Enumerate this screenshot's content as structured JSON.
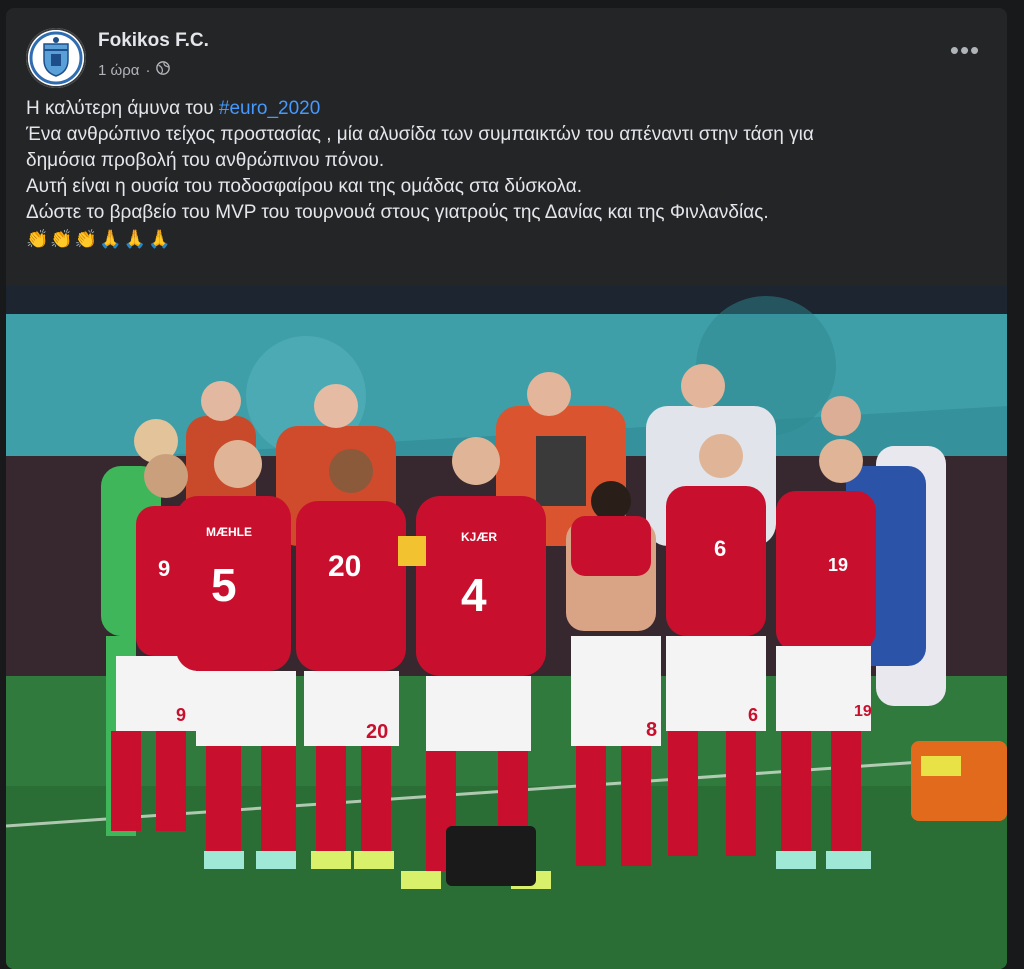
{
  "post": {
    "page_name": "Fokikos F.C.",
    "time": "1 ώρα",
    "separator": "·",
    "privacy_icon": "globe-icon",
    "more_icon": "more-options-icon",
    "avatar_icon": "club-crest-logo",
    "text_line1_prefix": "Η καλύτερη άμυνα του ",
    "hashtag": "#euro_2020",
    "text_line2": "Ένα ανθρώπινο τείχος προστασίας , μία αλυσίδα των συμπαικτών του απέναντι στην τάση για",
    "text_line3": "δημόσια προβολή του ανθρώπινου πόνου.",
    "text_line4": "Αυτή είναι η ουσία του ποδοσφαίρου και της ομάδας στα δύσκολα.",
    "text_line5": "Δώστε το βραβείο του MVP του τουρνουά στους γιατρούς της Δανίας και της Φινλανδίας.",
    "emojis": "👏👏👏🙏🙏🙏"
  },
  "photo": {
    "jersey_numbers": [
      "9",
      "5",
      "20",
      "4",
      "6",
      "19"
    ],
    "jersey_names": [
      "MÆHLE",
      "KJÆR"
    ],
    "shorts_numbers": [
      "9",
      "20",
      "8",
      "6",
      "19"
    ]
  },
  "colors": {
    "background": "#18191a",
    "card": "#242526",
    "hashtag": "#4599ff",
    "jersey_red": "#c8102e",
    "pitch_green": "#2f7a3c"
  }
}
